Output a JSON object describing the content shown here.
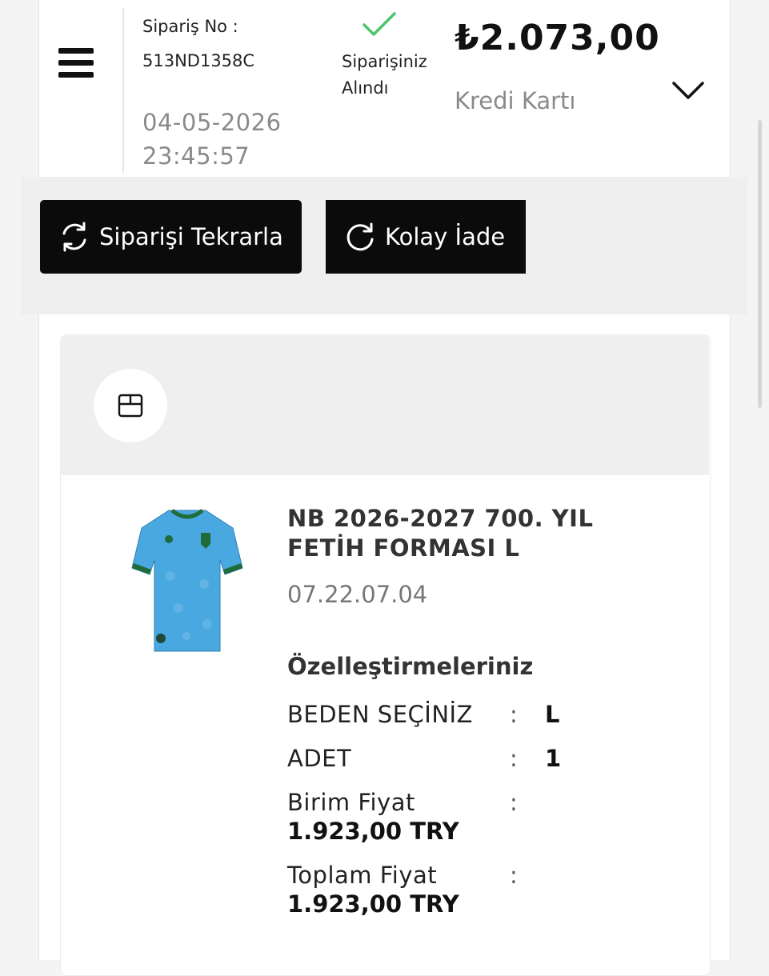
{
  "order": {
    "label": "Sipariş No :",
    "number": "513ND1358C",
    "date": "04-05-2026",
    "time": "23:45:57",
    "status": "Siparişiniz Alındı",
    "total": "₺2.073,00",
    "payment_method": "Kredi Kartı"
  },
  "actions": {
    "repeat_label": "Siparişi Tekrarla",
    "return_label": "Kolay İade"
  },
  "product": {
    "name": "NB 2026-2027 700. YIL FETİH FORMASI L",
    "code": "07.22.07.04",
    "customizations_title": "Özelleştirmeleriniz",
    "size_label": "BEDEN SEÇİNİZ",
    "size_value": "L",
    "qty_label": "ADET",
    "qty_value": "1",
    "unit_price_label": "Birim Fiyat",
    "unit_price": "1.923,00 TRY",
    "total_price_label": "Toplam Fiyat",
    "total_price": "1.923,00 TRY",
    "colon": ":"
  },
  "colors": {
    "accent_check": "#4cc46b",
    "button_bg": "#0b0b0b",
    "jersey": "#4aa8e0"
  },
  "icons": {
    "menu": "hamburger-icon",
    "status": "check-icon",
    "expand": "chevron-down-icon",
    "repeat": "refresh-icon",
    "return": "rotate-cw-icon",
    "package": "box-icon"
  }
}
